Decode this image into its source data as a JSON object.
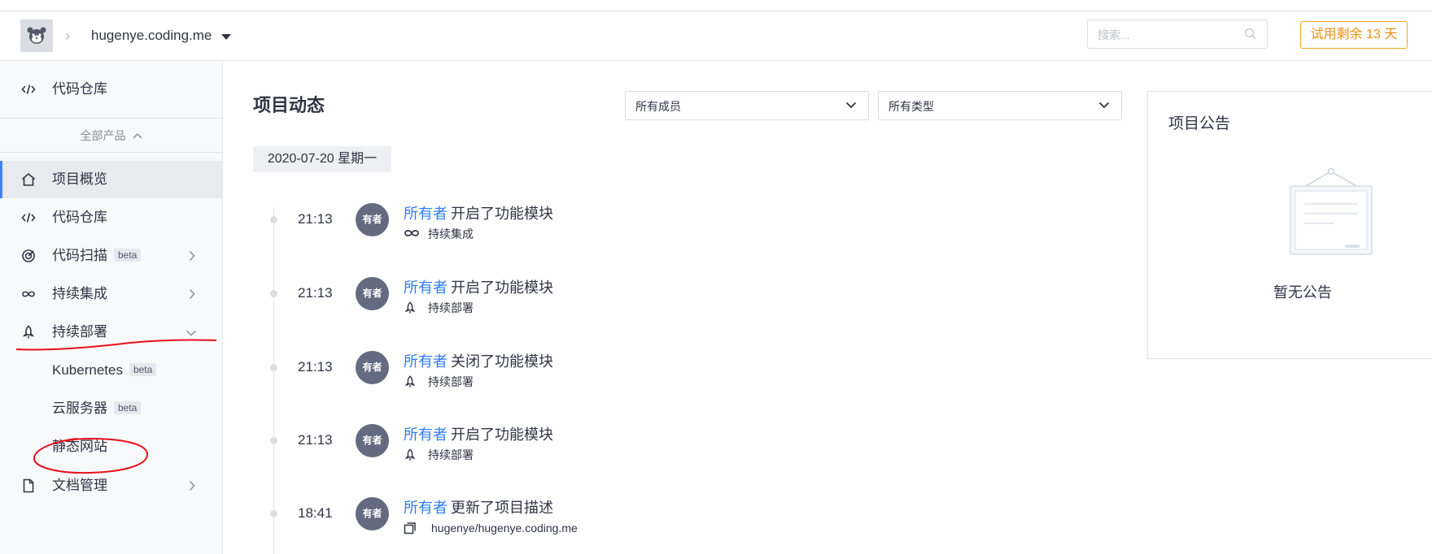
{
  "header": {
    "project_name": "hugenye.coding.me",
    "breadcrumb_separator": "›",
    "search_placeholder": "搜索...",
    "trial_label": "试用剩余 13 天"
  },
  "sidebar": {
    "top_item": {
      "label": "代码仓库",
      "icon": "code-icon"
    },
    "all_products_label": "全部产品",
    "items": [
      {
        "label": "项目概览",
        "icon": "home-icon",
        "active": true
      },
      {
        "label": "代码仓库",
        "icon": "code-icon"
      },
      {
        "label": "代码扫描",
        "icon": "scan-icon",
        "badge": "beta",
        "has_arrow": true
      },
      {
        "label": "持续集成",
        "icon": "infinity-icon",
        "has_arrow": true
      },
      {
        "label": "持续部署",
        "icon": "rocket-icon",
        "expanded": true
      },
      {
        "label": "文档管理",
        "icon": "document-icon",
        "has_arrow": true
      }
    ],
    "subitems": [
      {
        "label": "Kubernetes",
        "badge": "beta"
      },
      {
        "label": "云服务器",
        "badge": "beta"
      },
      {
        "label": "静态网站"
      }
    ]
  },
  "main": {
    "title": "项目动态",
    "member_filter": "所有成员",
    "type_filter": "所有类型",
    "date_label": "2020-07-20 星期一",
    "events": [
      {
        "time": "21:13",
        "avatar_text": "有者",
        "user": "所有者",
        "action": "开启了功能模块",
        "detail_icon": "infinity-icon",
        "detail": "持续集成"
      },
      {
        "time": "21:13",
        "avatar_text": "有者",
        "user": "所有者",
        "action": "开启了功能模块",
        "detail_icon": "rocket-icon",
        "detail": "持续部署"
      },
      {
        "time": "21:13",
        "avatar_text": "有者",
        "user": "所有者",
        "action": "关闭了功能模块",
        "detail_icon": "rocket-icon",
        "detail": "持续部署"
      },
      {
        "time": "21:13",
        "avatar_text": "有者",
        "user": "所有者",
        "action": "开启了功能模块",
        "detail_icon": "rocket-icon",
        "detail": "持续部署"
      },
      {
        "time": "18:41",
        "avatar_text": "有者",
        "user": "所有者",
        "action": "更新了项目描述",
        "detail_icon": "copy-icon",
        "detail": "hugenye/hugenye.coding.me"
      }
    ]
  },
  "notice": {
    "title": "项目公告",
    "empty_text": "暂无公告"
  },
  "colors": {
    "accent": "#3d7ff4",
    "link": "#2e7cf6",
    "trial": "#f08c12",
    "annotation": "#e8101c",
    "avatar_bg": "#646b80"
  }
}
